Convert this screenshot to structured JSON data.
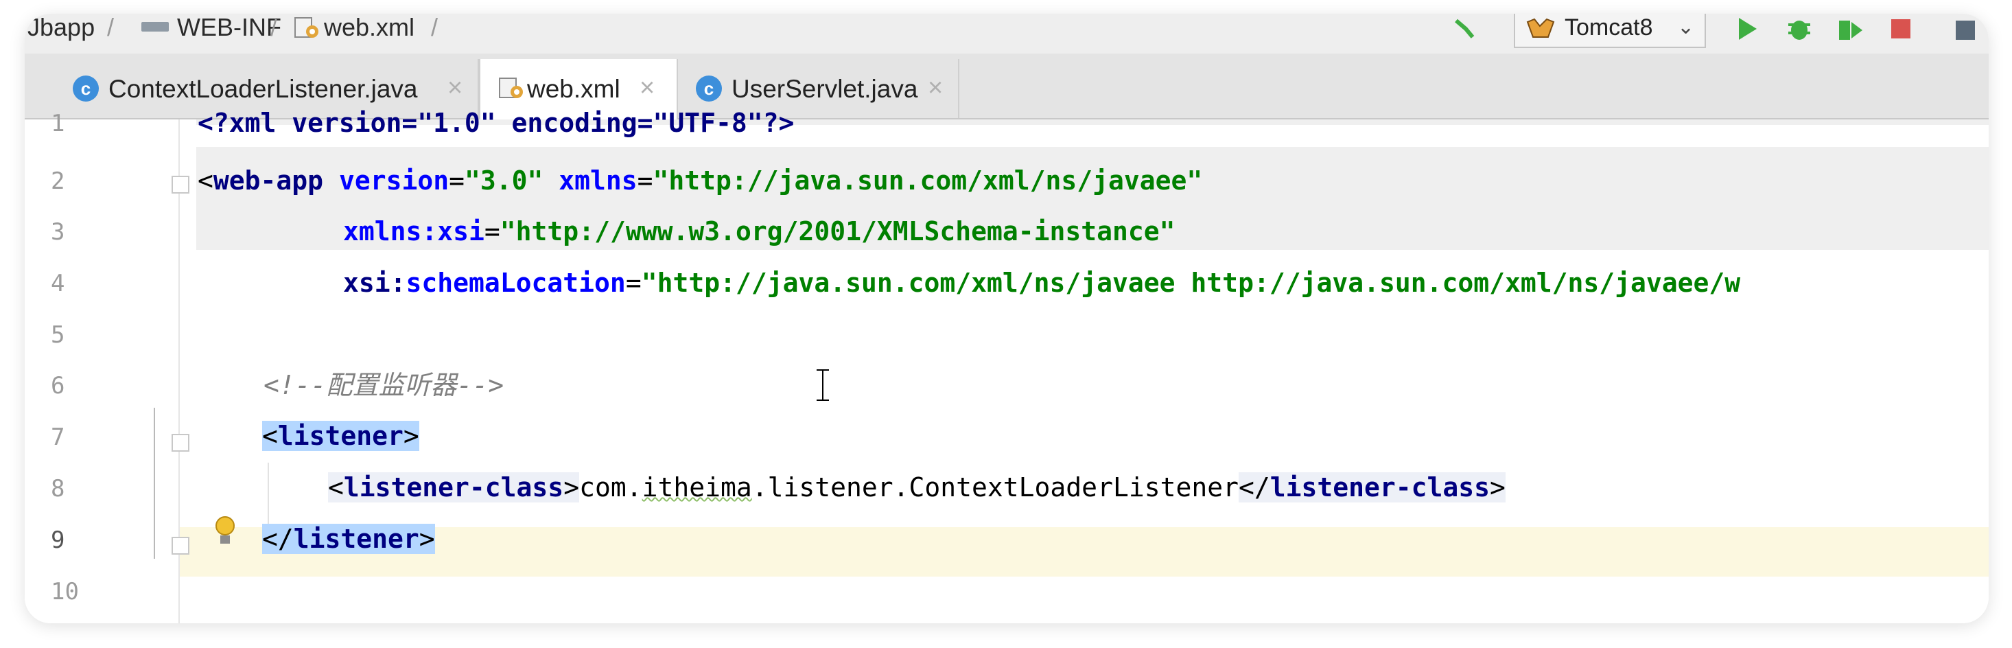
{
  "breadcrumb": {
    "items": [
      "Jbapp",
      "WEB-INF",
      "web.xml"
    ],
    "separator": "/"
  },
  "toolbar": {
    "run_config_label": "Tomcat8",
    "build_icon": "hammer-icon",
    "run_icon": "run-icon",
    "debug_icon": "debug-icon",
    "coverage_icon": "coverage-icon",
    "stop_icon": "stop-icon",
    "accent_green": "#3fae42",
    "stop_color": "#d9534f"
  },
  "tabs": [
    {
      "label": "ContextLoaderListener.java",
      "icon": "java-class-icon",
      "active": false,
      "close": "×"
    },
    {
      "label": "web.xml",
      "icon": "xml-file-icon",
      "active": true,
      "close": "×"
    },
    {
      "label": "UserServlet.java",
      "icon": "java-class-icon",
      "active": false,
      "close": "×"
    }
  ],
  "editor": {
    "line_numbers": [
      "1",
      "2",
      "3",
      "4",
      "5",
      "6",
      "7",
      "8",
      "9",
      "10"
    ],
    "current_line": "9",
    "lines": {
      "l1": "<?xml version=\"1.0\" encoding=\"UTF-8\"?>",
      "l2_open": "<",
      "l2_tag": "web-app",
      "l2_attr1": "version",
      "l2_val1": "\"3.0\"",
      "l2_attr2": "xmlns",
      "l2_val2": "\"http://java.sun.com/xml/ns/javaee\"",
      "l3_attr": "xmlns:xsi",
      "l3_val": "\"http://www.w3.org/2001/XMLSchema-instance\"",
      "l4_attr_ns": "xsi:",
      "l4_attr": "schemaLocation",
      "l4_val": "\"http://java.sun.com/xml/ns/javaee http://java.sun.com/xml/ns/javaee/w",
      "l6_comment": "<!--配置监听器-->",
      "l7_lt": "<",
      "l7_tag": "listener",
      "l7_gt": ">",
      "l8_open_lt": "<",
      "l8_tag": "listener-class",
      "l8_open_gt": ">",
      "l8_text_a": "com.",
      "l8_text_b": "itheima",
      "l8_text_c": ".listener.ContextLoaderListener",
      "l8_close_lt": "</",
      "l8_close_gt": ">",
      "l9_lt": "</",
      "l9_tag": "listener",
      "l9_gt": ">"
    },
    "highlight_color": "#b4d7ff",
    "current_line_color": "#fcf8e0"
  }
}
